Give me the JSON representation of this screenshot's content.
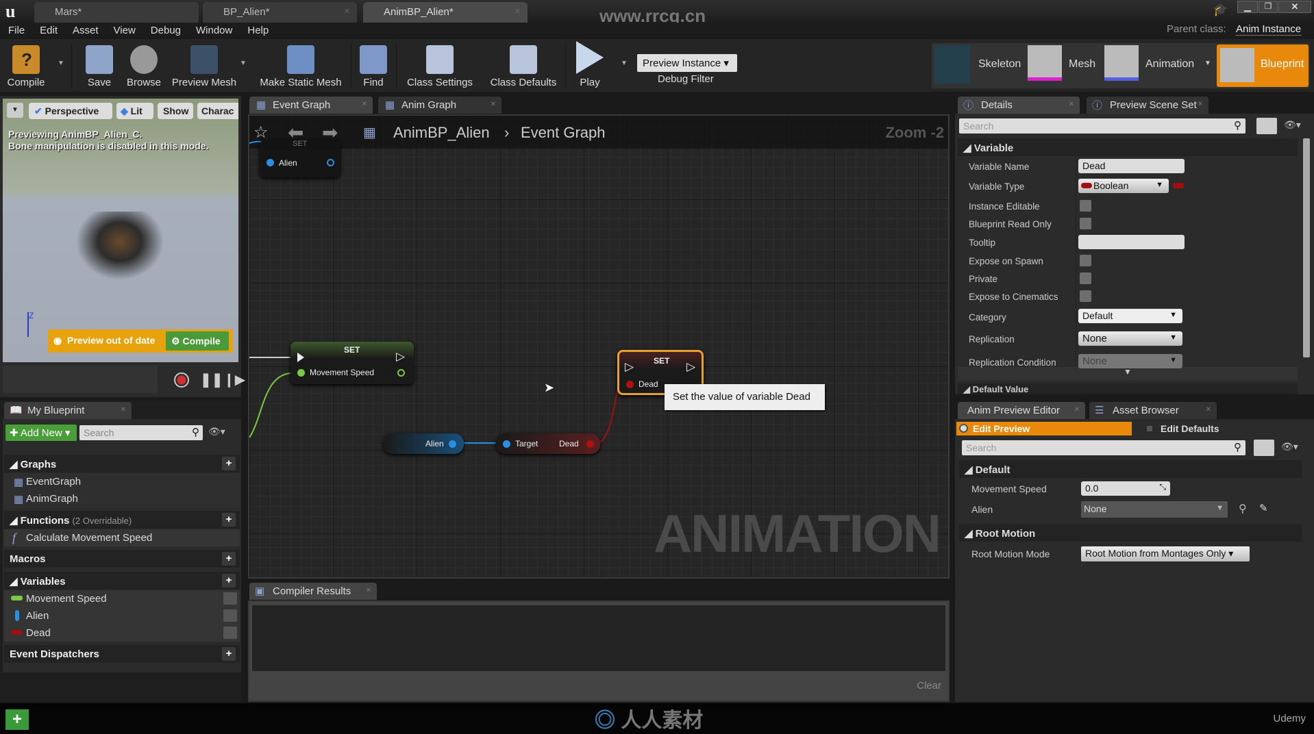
{
  "window": {
    "tabs": [
      {
        "label": "Mars*"
      },
      {
        "label": "BP_Alien*"
      },
      {
        "label": "AnimBP_Alien*"
      }
    ],
    "watermark": "www.rrcg.cn",
    "parent_class_label": "Parent class:",
    "parent_class": "Anim Instance"
  },
  "menu": [
    "File",
    "Edit",
    "Asset",
    "View",
    "Debug",
    "Window",
    "Help"
  ],
  "toolbar": {
    "compile": "Compile",
    "save": "Save",
    "browse": "Browse",
    "preview_mesh": "Preview Mesh",
    "make_static_mesh": "Make Static Mesh",
    "find": "Find",
    "class_settings": "Class Settings",
    "class_defaults": "Class Defaults",
    "play": "Play",
    "debug_select": "Preview Instance",
    "debug_filter": "Debug Filter"
  },
  "modes": {
    "skeleton": "Skeleton",
    "mesh": "Mesh",
    "animation": "Animation",
    "blueprint": "Blueprint",
    "active": "Blueprint",
    "accent": "#e8890c"
  },
  "viewport": {
    "buttons": [
      "Perspective",
      "Lit",
      "Show",
      "Charac"
    ],
    "info_line1": "Previewing AnimBP_Alien_C.",
    "info_line2": "Bone manipulation is disabled in this mode.",
    "axis_label": "Z",
    "warning": "Preview out of date",
    "compile": "Compile"
  },
  "my_blueprint": {
    "tab": "My Blueprint",
    "add_new": "Add New",
    "search_placeholder": "Search",
    "graphs_header": "Graphs",
    "graphs": [
      "EventGraph",
      "AnimGraph"
    ],
    "functions_header": "Functions",
    "functions_note": "(2 Overridable)",
    "functions": [
      "Calculate Movement Speed"
    ],
    "macros_header": "Macros",
    "variables_header": "Variables",
    "variables": [
      {
        "name": "Movement Speed",
        "color": "#7ac943"
      },
      {
        "name": "Alien",
        "color": "#2a8fe0"
      },
      {
        "name": "Dead",
        "color": "#a01010"
      }
    ],
    "dispatchers_header": "Event Dispatchers"
  },
  "graph": {
    "tabs": [
      "Event Graph",
      "Anim Graph"
    ],
    "breadcrumb_root": "AnimBP_Alien",
    "breadcrumb_leaf": "Event Graph",
    "zoom": "Zoom -2",
    "watermark": "ANIMATION",
    "nodes": {
      "set_alien": {
        "title": "SET",
        "pin": "Alien"
      },
      "set_speed": {
        "title": "SET",
        "pin": "Movement Speed"
      },
      "set_dead": {
        "title": "SET",
        "pin": "Dead"
      },
      "get_alien": {
        "pin": "Alien"
      },
      "get_dead": {
        "target": "Target",
        "out": "Dead"
      }
    },
    "tooltip": "Set the value of variable Dead"
  },
  "compiler": {
    "tab": "Compiler Results",
    "clear": "Clear"
  },
  "details": {
    "tabs": [
      "Details",
      "Preview Scene Set"
    ],
    "search_placeholder": "Search",
    "section": "Variable",
    "rows": {
      "variable_name": {
        "label": "Variable Name",
        "value": "Dead"
      },
      "variable_type": {
        "label": "Variable Type",
        "value": "Boolean"
      },
      "instance_editable": {
        "label": "Instance Editable",
        "checked": false
      },
      "read_only": {
        "label": "Blueprint Read Only",
        "checked": false
      },
      "tooltip": {
        "label": "Tooltip",
        "value": ""
      },
      "expose_spawn": {
        "label": "Expose on Spawn",
        "checked": false
      },
      "private": {
        "label": "Private",
        "checked": false
      },
      "expose_cinematics": {
        "label": "Expose to Cinematics",
        "checked": false
      },
      "category": {
        "label": "Category",
        "value": "Default"
      },
      "replication": {
        "label": "Replication",
        "value": "None"
      },
      "replication_condition": {
        "label": "Replication Condition",
        "value": "None"
      }
    },
    "next_section": "Default Value"
  },
  "anim_preview": {
    "tabs": [
      "Anim Preview Editor",
      "Asset Browser"
    ],
    "edit_preview": "Edit Preview",
    "edit_defaults": "Edit Defaults",
    "search_placeholder": "Search",
    "default_section": "Default",
    "movement_speed_label": "Movement Speed",
    "movement_speed": "0.0",
    "alien_label": "Alien",
    "alien": "None",
    "root_section": "Root Motion",
    "root_mode_label": "Root Motion Mode",
    "root_mode": "Root Motion from Montages Only"
  },
  "footer": {
    "watermark": "人人素材",
    "brand": "Udemy"
  }
}
